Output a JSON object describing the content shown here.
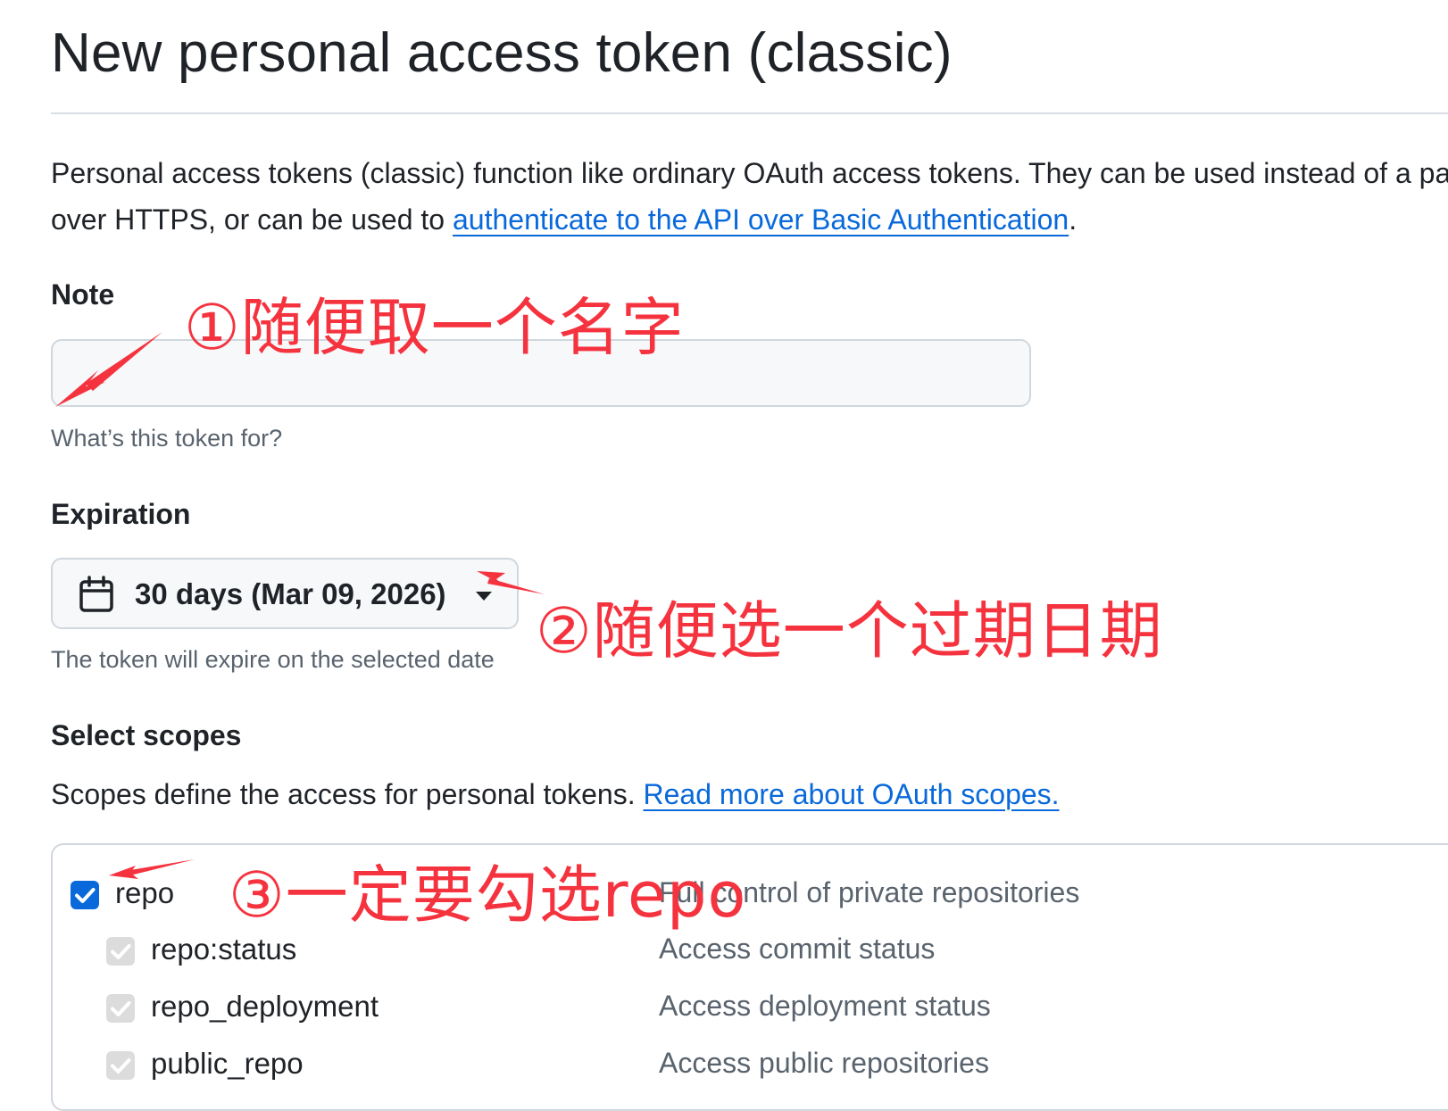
{
  "page": {
    "title": "New personal access token (classic)",
    "intro_text": "Personal access tokens (classic) function like ordinary OAuth access tokens. They can be used instead of a password for Git",
    "intro_text_2": "over HTTPS, or can be used to ",
    "intro_link": "authenticate to the API over Basic Authentication",
    "intro_end": "."
  },
  "note": {
    "label": "Note",
    "value": "",
    "placeholder": "",
    "hint": "What’s this token for?"
  },
  "expiration": {
    "label": "Expiration",
    "selected": "30 days (Mar 09, 2026)",
    "hint": "The token will expire on the selected date"
  },
  "scopes": {
    "label": "Select scopes",
    "text": "Scopes define the access for personal tokens. ",
    "link": "Read more about OAuth scopes.",
    "items": [
      {
        "name": "repo",
        "description": "Full control of private repositories",
        "checked": true,
        "child": false
      },
      {
        "name": "repo:status",
        "description": "Access commit status",
        "checked": true,
        "child": true
      },
      {
        "name": "repo_deployment",
        "description": "Access deployment status",
        "checked": true,
        "child": true
      },
      {
        "name": "public_repo",
        "description": "Access public repositories",
        "checked": true,
        "child": true
      }
    ]
  },
  "annotations": {
    "step1": "①随便取一个名字",
    "step2": "②随便选一个过期日期",
    "step3": "③一定要勾选repo",
    "color": "#f5333f"
  },
  "colors": {
    "link": "#0969da",
    "checkbox_on": "#0969da",
    "muted_text": "#59636e",
    "border": "#d0d7de"
  }
}
